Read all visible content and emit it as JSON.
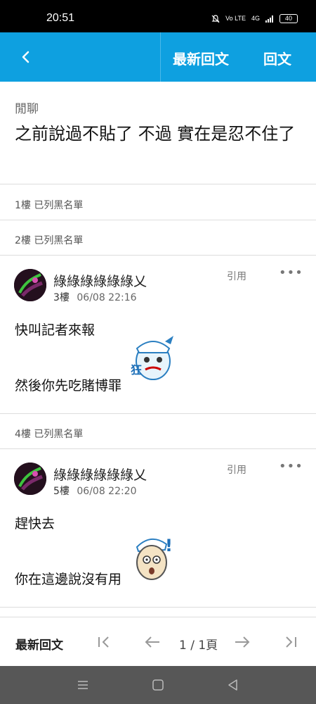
{
  "status": {
    "time": "20:51",
    "net1": "Vo LTE",
    "net2": "4G",
    "battery": "40"
  },
  "header": {
    "latest_label": "最新回文",
    "reply_label": "回文"
  },
  "thread": {
    "category": "閒聊",
    "title": "之前說過不貼了 不過 實在是忍不住了"
  },
  "blocked": [
    {
      "text": "1樓 已列黑名單"
    },
    {
      "text": "2樓 已列黑名單"
    },
    {
      "text": "4樓 已列黑名單"
    }
  ],
  "posts": [
    {
      "username": "綠綠綠綠綠綠乂",
      "floor": "3樓",
      "datetime": "06/08 22:16",
      "quote": "引用",
      "more": "•••",
      "lines": [
        "快叫記者來報",
        "然後你先吃賭博罪"
      ],
      "sticker_char": "狂"
    },
    {
      "username": "綠綠綠綠綠綠乂",
      "floor": "5樓",
      "datetime": "06/08 22:20",
      "quote": "引用",
      "more": "•••",
      "lines": [
        "趕快去",
        "你在這邊說沒有用"
      ],
      "sticker_char": "!"
    }
  ],
  "footer": {
    "latest_label": "最新回文",
    "page_text": "1 / 1頁"
  },
  "colors": {
    "accent": "#0ea0e0"
  }
}
